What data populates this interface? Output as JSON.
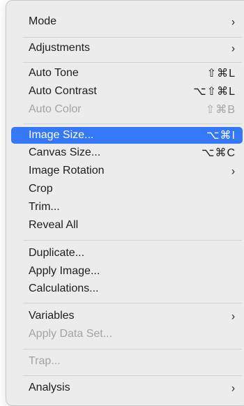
{
  "menu": {
    "groups": [
      [
        {
          "label": "Mode",
          "submenu_glyph": "›"
        }
      ],
      [
        {
          "label": "Adjustments",
          "submenu_glyph": "›"
        }
      ],
      [
        {
          "label": "Auto Tone",
          "shortcut": "⇧⌘L"
        },
        {
          "label": "Auto Contrast",
          "shortcut": "⌥⇧⌘L"
        },
        {
          "label": "Auto Color",
          "shortcut": "⇧⌘B",
          "disabled": true
        }
      ],
      [
        {
          "label": "Image Size...",
          "shortcut": "⌥⌘I",
          "selected": true
        },
        {
          "label": "Canvas Size...",
          "shortcut": "⌥⌘C"
        },
        {
          "label": "Image Rotation",
          "submenu_glyph": "›"
        },
        {
          "label": "Crop"
        },
        {
          "label": "Trim..."
        },
        {
          "label": "Reveal All"
        }
      ],
      [
        {
          "label": "Duplicate..."
        },
        {
          "label": "Apply Image..."
        },
        {
          "label": "Calculations..."
        }
      ],
      [
        {
          "label": "Variables",
          "submenu_glyph": "›"
        },
        {
          "label": "Apply Data Set...",
          "disabled": true
        }
      ],
      [
        {
          "label": "Trap...",
          "disabled": true
        }
      ],
      [
        {
          "label": "Analysis",
          "submenu_glyph": "›"
        }
      ]
    ],
    "colors": {
      "background": "#ececec",
      "highlight": "#3478f6",
      "text": "#1d1d1f",
      "disabled_text": "#a3a3a5",
      "separator": "#d2d2d4"
    }
  }
}
